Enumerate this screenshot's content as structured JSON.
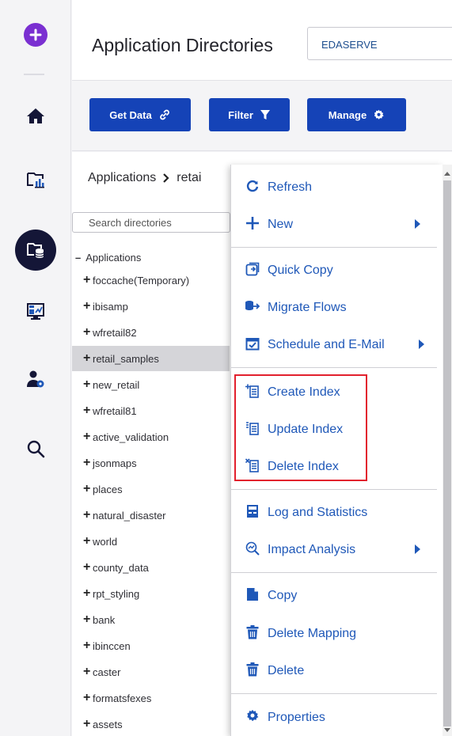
{
  "header": {
    "title": "Application Directories",
    "server": "EDASERVE"
  },
  "toolbar": {
    "get_data": "Get Data",
    "filter": "Filter",
    "manage": "Manage"
  },
  "breadcrumb": {
    "root": "Applications",
    "current": "retai"
  },
  "search": {
    "placeholder": "Search directories"
  },
  "tree": {
    "root": "Applications",
    "items": [
      "foccache(Temporary)",
      "ibisamp",
      "wfretail82",
      "retail_samples",
      "new_retail",
      "wfretail81",
      "active_validation",
      "jsonmaps",
      "places",
      "natural_disaster",
      "world",
      "county_data",
      "rpt_styling",
      "bank",
      "ibinccen",
      "caster",
      "formatsfexes",
      "assets"
    ],
    "selected": "retail_samples"
  },
  "menu": {
    "refresh": "Refresh",
    "new": "New",
    "quick_copy": "Quick Copy",
    "migrate_flows": "Migrate Flows",
    "schedule": "Schedule and E-Mail",
    "create_index": "Create Index",
    "update_index": "Update Index",
    "delete_index": "Delete Index",
    "log_stats": "Log and Statistics",
    "impact": "Impact Analysis",
    "copy": "Copy",
    "delete_mapping": "Delete Mapping",
    "delete": "Delete",
    "properties": "Properties"
  },
  "colors": {
    "primary": "#1543b7",
    "menu_text": "#1f58b8",
    "highlight": "#e2202d",
    "rail_active": "#141637",
    "accent_purple": "#7a2fd1"
  }
}
